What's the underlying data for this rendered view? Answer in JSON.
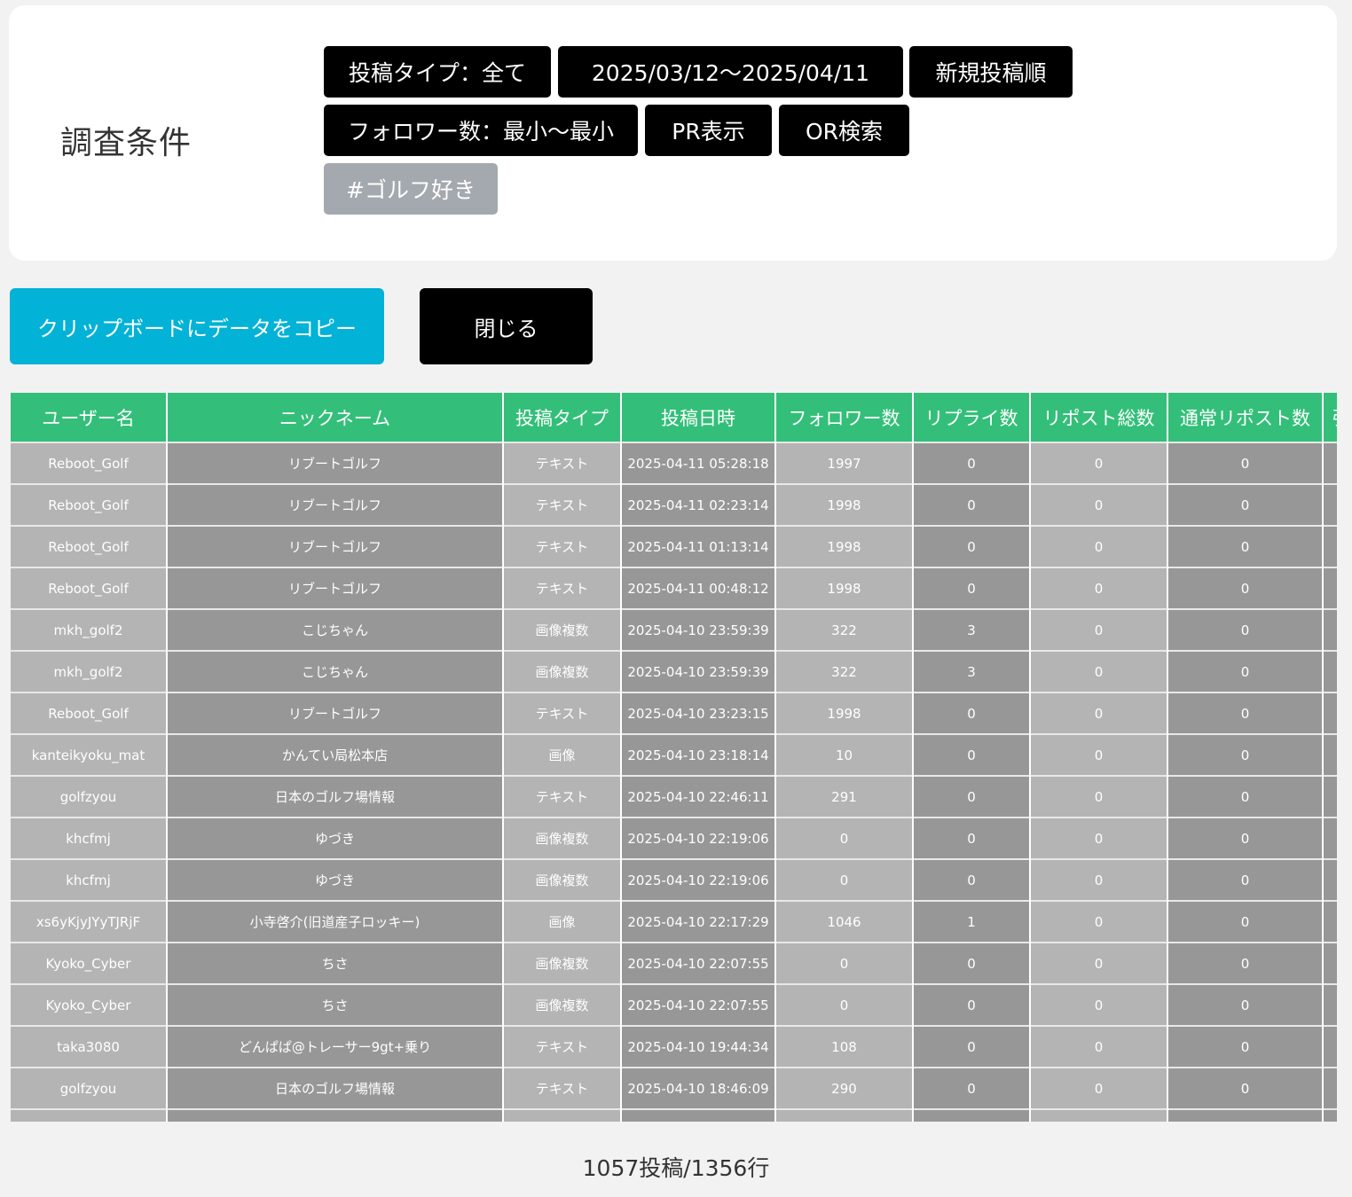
{
  "conditions": {
    "title": "調査条件",
    "chips": [
      {
        "label": "投稿タイプ：全て"
      },
      {
        "label": "2025/03/12〜2025/04/11"
      },
      {
        "label": "新規投稿順"
      },
      {
        "label": "フォロワー数：最小〜最小"
      },
      {
        "label": "PR表示"
      },
      {
        "label": "OR検索"
      },
      {
        "label": "#ゴルフ好き"
      }
    ]
  },
  "actions": {
    "copy_label": "クリップボードにデータをコピー",
    "close_label": "閉じる"
  },
  "colors": {
    "header_green": "#33bf79",
    "copy_button": "#03b2d7",
    "chip_black": "#000000",
    "chip_gray": "#a3a9ae"
  },
  "table": {
    "headers": [
      "ユーザー名",
      "ニックネーム",
      "投稿タイプ",
      "投稿日時",
      "フォロワー数",
      "リプライ数",
      "リポスト総数",
      "通常リポスト数",
      "引"
    ],
    "rows": [
      [
        "Reboot_Golf",
        "リブートゴルフ",
        "テキスト",
        "2025-04-11 05:28:18",
        "1997",
        "0",
        "0",
        "0",
        ""
      ],
      [
        "Reboot_Golf",
        "リブートゴルフ",
        "テキスト",
        "2025-04-11 02:23:14",
        "1998",
        "0",
        "0",
        "0",
        ""
      ],
      [
        "Reboot_Golf",
        "リブートゴルフ",
        "テキスト",
        "2025-04-11 01:13:14",
        "1998",
        "0",
        "0",
        "0",
        ""
      ],
      [
        "Reboot_Golf",
        "リブートゴルフ",
        "テキスト",
        "2025-04-11 00:48:12",
        "1998",
        "0",
        "0",
        "0",
        ""
      ],
      [
        "mkh_golf2",
        "こじちゃん",
        "画像複数",
        "2025-04-10 23:59:39",
        "322",
        "3",
        "0",
        "0",
        ""
      ],
      [
        "mkh_golf2",
        "こじちゃん",
        "画像複数",
        "2025-04-10 23:59:39",
        "322",
        "3",
        "0",
        "0",
        ""
      ],
      [
        "Reboot_Golf",
        "リブートゴルフ",
        "テキスト",
        "2025-04-10 23:23:15",
        "1998",
        "0",
        "0",
        "0",
        ""
      ],
      [
        "kanteikyoku_mat",
        "かんてい局松本店",
        "画像",
        "2025-04-10 23:18:14",
        "10",
        "0",
        "0",
        "0",
        ""
      ],
      [
        "golfzyou",
        "日本のゴルフ場情報",
        "テキスト",
        "2025-04-10 22:46:11",
        "291",
        "0",
        "0",
        "0",
        ""
      ],
      [
        "khcfmj",
        "ゆづき",
        "画像複数",
        "2025-04-10 22:19:06",
        "0",
        "0",
        "0",
        "0",
        ""
      ],
      [
        "khcfmj",
        "ゆづき",
        "画像複数",
        "2025-04-10 22:19:06",
        "0",
        "0",
        "0",
        "0",
        ""
      ],
      [
        "xs6yKjyJYyTJRjF",
        "小寺啓介(旧道産子ロッキー)",
        "画像",
        "2025-04-10 22:17:29",
        "1046",
        "1",
        "0",
        "0",
        ""
      ],
      [
        "Kyoko_Cyber",
        "ちさ",
        "画像複数",
        "2025-04-10 22:07:55",
        "0",
        "0",
        "0",
        "0",
        ""
      ],
      [
        "Kyoko_Cyber",
        "ちさ",
        "画像複数",
        "2025-04-10 22:07:55",
        "0",
        "0",
        "0",
        "0",
        ""
      ],
      [
        "taka3080",
        "どんぱぱ@トレーサー9gt+乗り",
        "テキスト",
        "2025-04-10 19:44:34",
        "108",
        "0",
        "0",
        "0",
        ""
      ],
      [
        "golfzyou",
        "日本のゴルフ場情報",
        "テキスト",
        "2025-04-10 18:46:09",
        "290",
        "0",
        "0",
        "0",
        ""
      ],
      [
        "",
        "",
        "",
        "",
        "",
        "",
        "",
        "",
        ""
      ]
    ]
  },
  "footer": {
    "count_text": "1057投稿/1356行"
  }
}
